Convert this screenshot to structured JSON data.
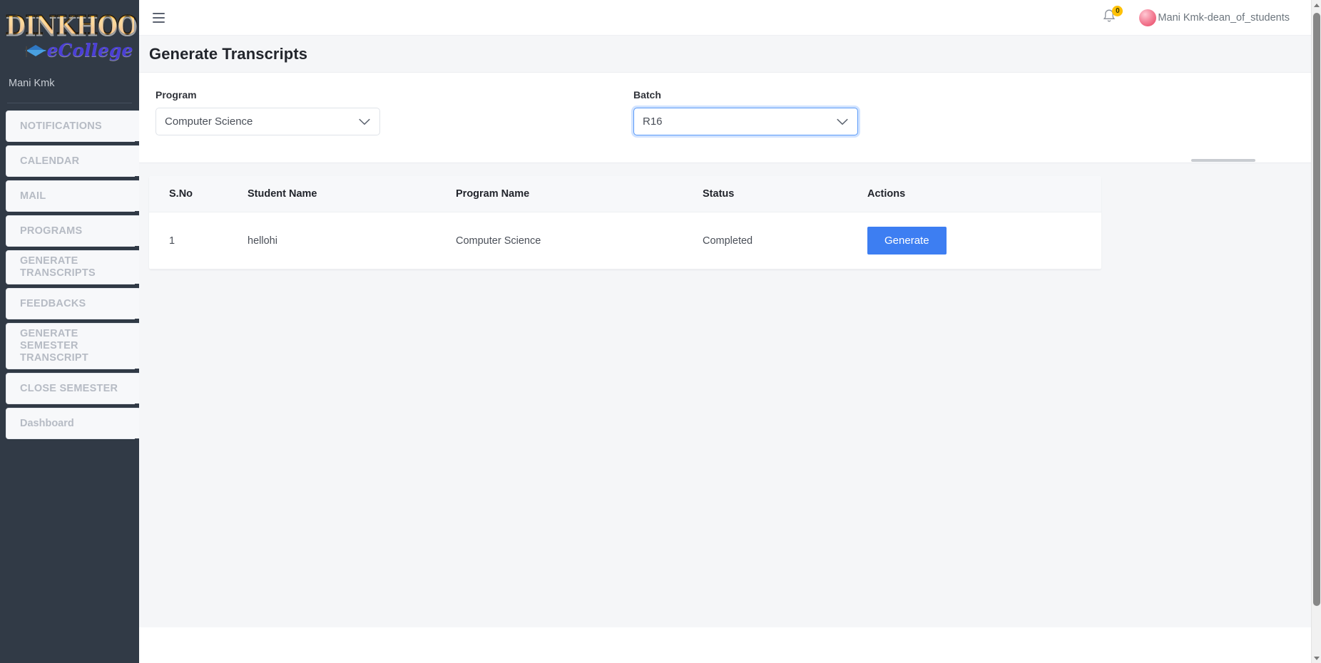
{
  "brand": {
    "logo_main": "DINKHOO!",
    "logo_sub": "eCollege",
    "cap_icon": "graduation-cap-icon"
  },
  "sidebar": {
    "user_name": "Mani Kmk",
    "items": [
      {
        "label": "NOTIFICATIONS"
      },
      {
        "label": "CALENDAR"
      },
      {
        "label": "MAIL"
      },
      {
        "label": "PROGRAMS"
      },
      {
        "label": "GENERATE TRANSCRIPTS"
      },
      {
        "label": "FEEDBACKS"
      },
      {
        "label": "GENERATE SEMESTER TRANSCRIPT"
      },
      {
        "label": "CLOSE SEMESTER"
      },
      {
        "label": "Dashboard"
      }
    ]
  },
  "topbar": {
    "menu_icon": "hamburger-icon",
    "notification_icon": "bell-icon",
    "notification_count": "0",
    "avatar_icon": "user-avatar",
    "profile_name": "Mani Kmk-dean_of_students"
  },
  "page": {
    "title": "Generate Transcripts"
  },
  "filters": {
    "program": {
      "label": "Program",
      "value": "Computer Science",
      "chevron_icon": "chevron-down-icon",
      "focused": false
    },
    "batch": {
      "label": "Batch",
      "value": "R16",
      "chevron_icon": "chevron-down-icon",
      "focused": true
    }
  },
  "table": {
    "columns": [
      "S.No",
      "Student Name",
      "Program Name",
      "Status",
      "Actions"
    ],
    "rows": [
      {
        "sno": "1",
        "student_name": "hellohi",
        "program_name": "Computer Science",
        "status": "Completed",
        "action_label": "Generate"
      }
    ]
  },
  "colors": {
    "sidebar_bg": "#313a46",
    "accent_blue": "#3d7ef2",
    "focus_blue": "#5b9bf8",
    "badge_yellow": "#ffc107",
    "page_bg": "#f5f6f8"
  }
}
